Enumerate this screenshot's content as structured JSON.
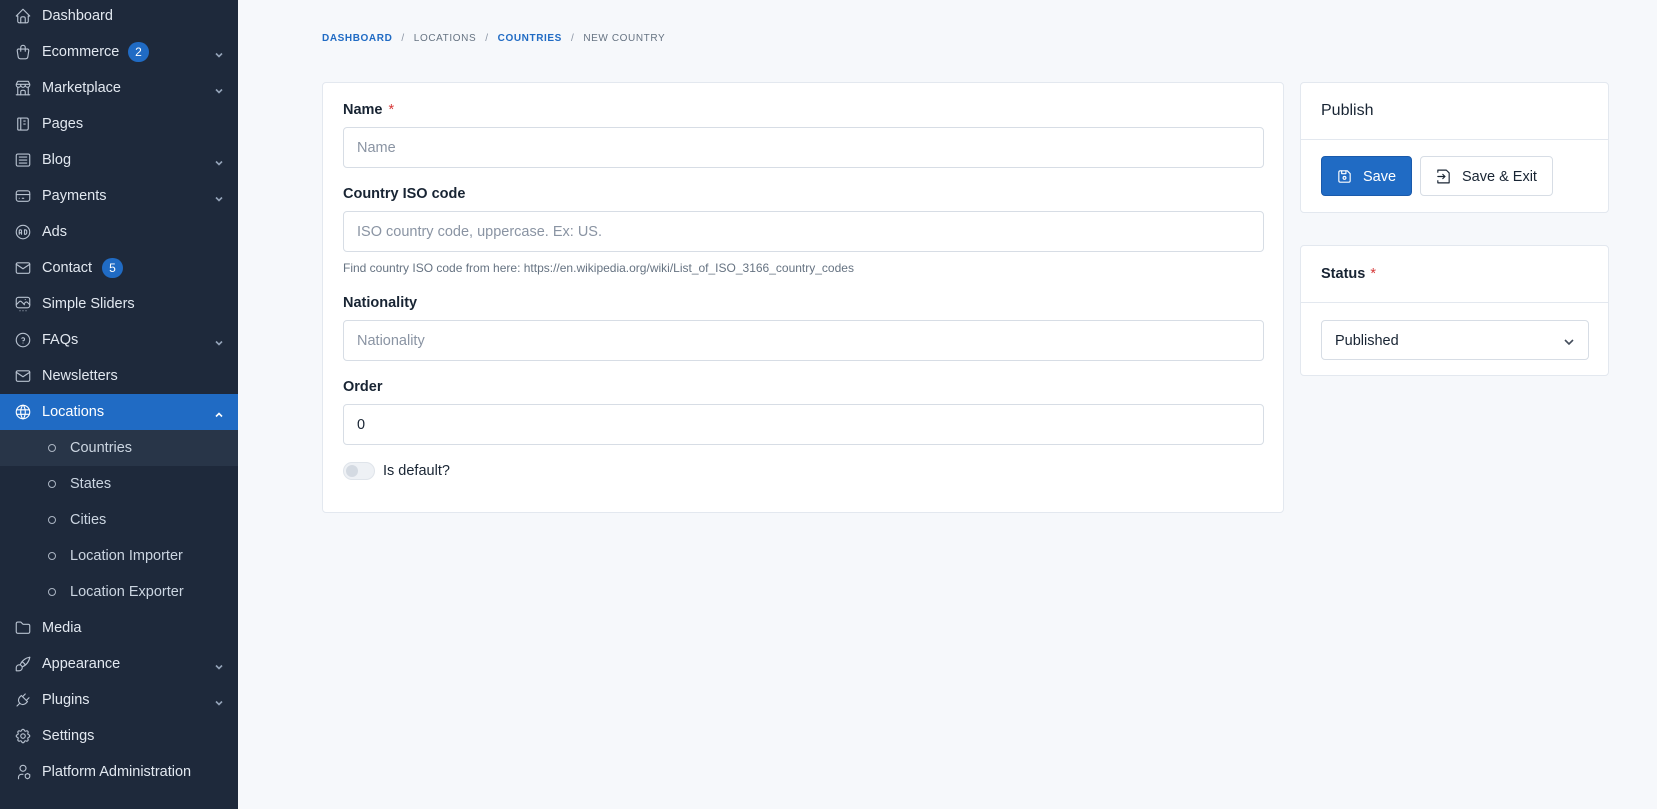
{
  "sidebar": {
    "items": [
      {
        "label": "Dashboard",
        "icon": "home-icon"
      },
      {
        "label": "Ecommerce",
        "icon": "shopping-bag-icon",
        "badge": "2"
      },
      {
        "label": "Marketplace",
        "icon": "store-icon"
      },
      {
        "label": "Pages",
        "icon": "notebook-icon"
      },
      {
        "label": "Blog",
        "icon": "article-icon"
      },
      {
        "label": "Payments",
        "icon": "credit-card-icon"
      },
      {
        "label": "Ads",
        "icon": "ad-circle-icon"
      },
      {
        "label": "Contact",
        "icon": "mail-icon",
        "badge": "5"
      },
      {
        "label": "Simple Sliders",
        "icon": "slideshow-icon"
      },
      {
        "label": "FAQs",
        "icon": "help-circle-icon"
      },
      {
        "label": "Newsletters",
        "icon": "mail-opened-icon"
      },
      {
        "label": "Locations",
        "icon": "globe-icon"
      },
      {
        "label": "Media",
        "icon": "folder-icon"
      },
      {
        "label": "Appearance",
        "icon": "brush-icon"
      },
      {
        "label": "Plugins",
        "icon": "plug-icon"
      },
      {
        "label": "Settings",
        "icon": "settings-icon"
      },
      {
        "label": "Platform Administration",
        "icon": "user-shield-icon"
      }
    ],
    "locations_children": [
      {
        "label": "Countries"
      },
      {
        "label": "States"
      },
      {
        "label": "Cities"
      },
      {
        "label": "Location Importer"
      },
      {
        "label": "Location Exporter"
      }
    ]
  },
  "breadcrumb": {
    "dashboard": "Dashboard",
    "locations": "Locations",
    "countries": "Countries",
    "current": "New country",
    "separator": "/"
  },
  "form": {
    "name_label": "Name",
    "name_placeholder": "Name",
    "name_value": "",
    "iso_label": "Country ISO code",
    "iso_placeholder": "ISO country code, uppercase. Ex: US.",
    "iso_value": "",
    "iso_hint": "Find country ISO code from here: https://en.wikipedia.org/wiki/List_of_ISO_3166_country_codes",
    "nationality_label": "Nationality",
    "nationality_placeholder": "Nationality",
    "nationality_value": "",
    "order_label": "Order",
    "order_value": "0",
    "default_label": "Is default?",
    "default_on": false,
    "required_marker": "*"
  },
  "publish": {
    "title": "Publish",
    "save_label": "Save",
    "save_exit_label": "Save & Exit"
  },
  "status": {
    "title": "Status",
    "required_marker": "*",
    "selected": "Published"
  },
  "colors": {
    "sidebar_bg": "#1e293b",
    "accent": "#206bc4",
    "page_bg": "#f6f8fb"
  }
}
